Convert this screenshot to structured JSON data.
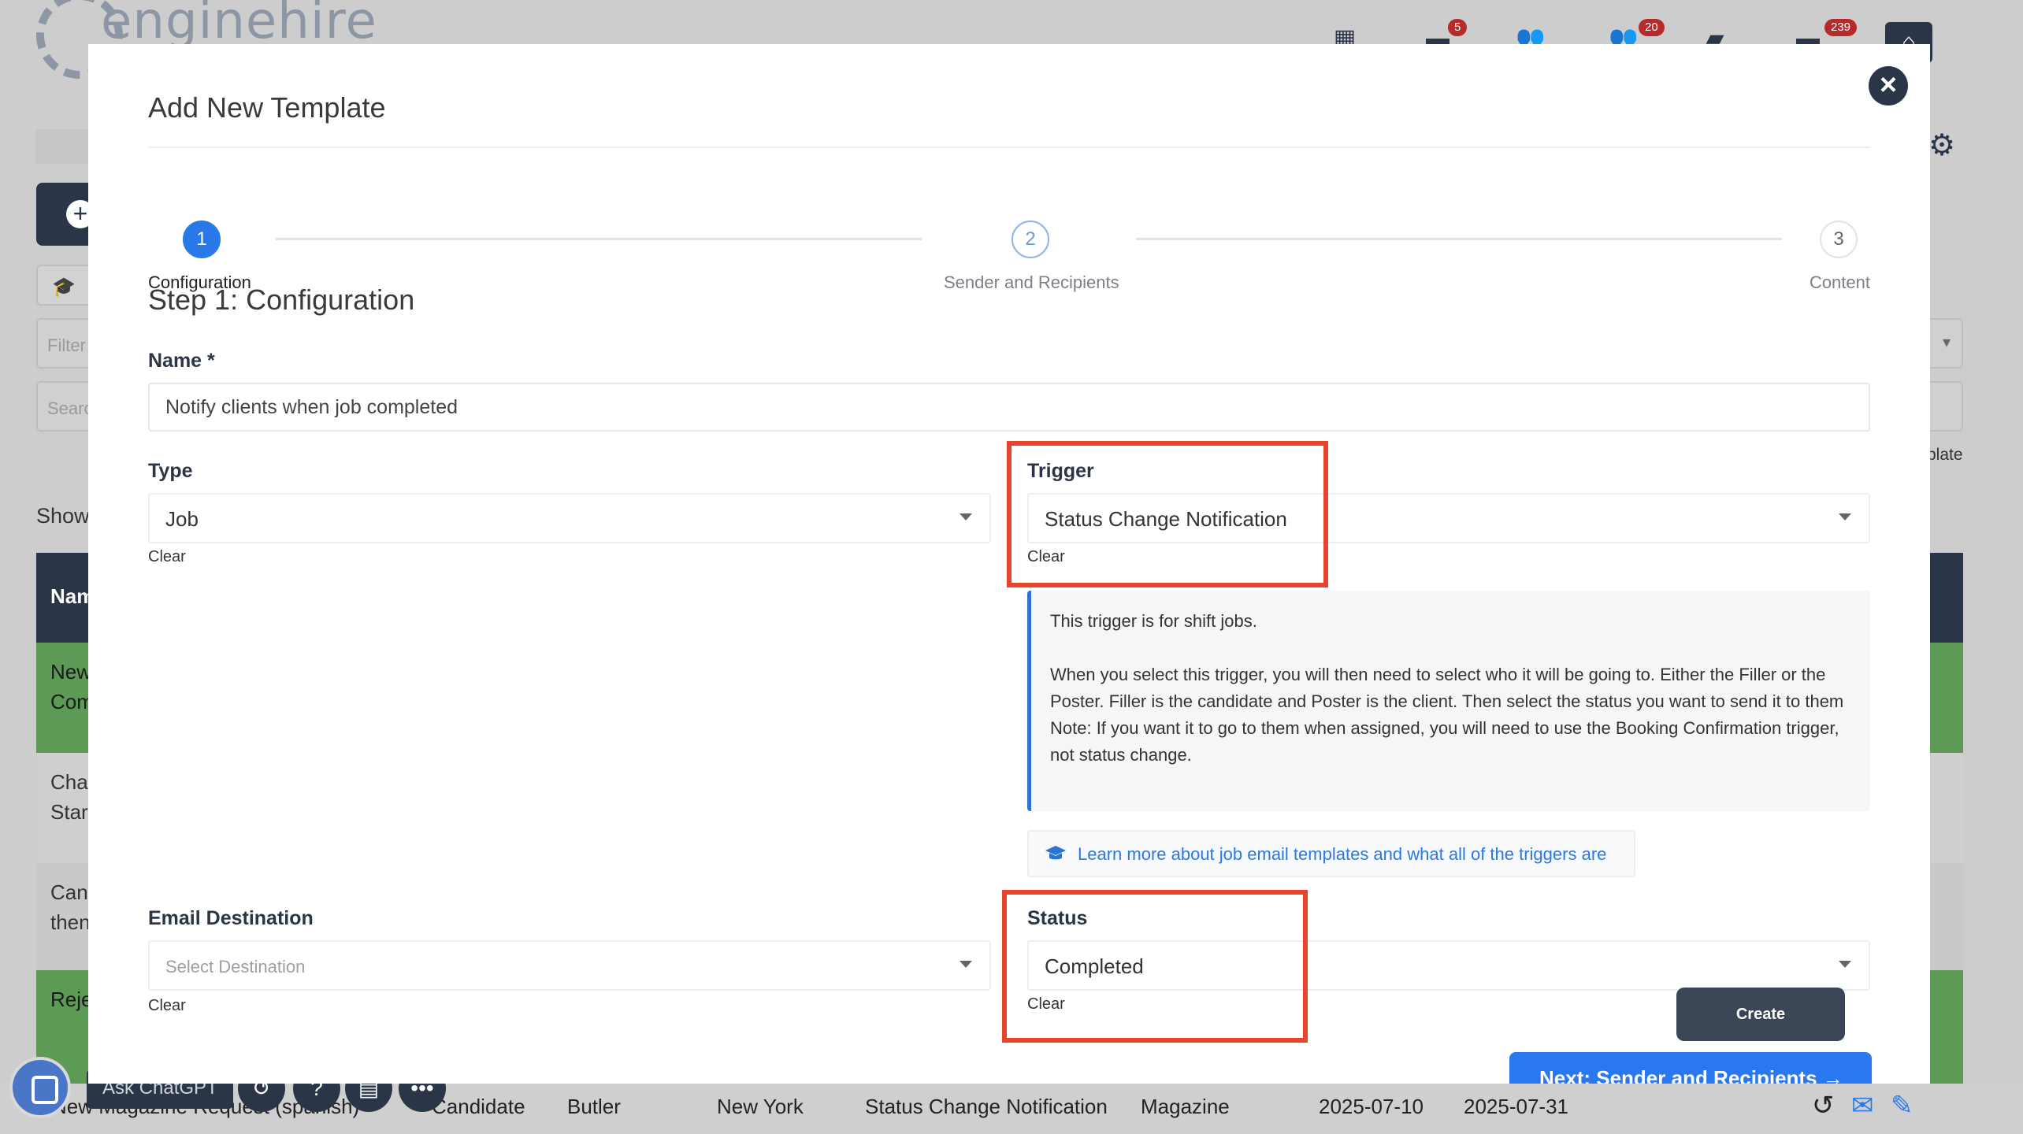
{
  "background": {
    "logo_text": "enginehire",
    "badges": {
      "messages": "5",
      "users": "20",
      "chat": "239"
    },
    "left_filter_placeholder": "Filter",
    "left_search_placeholder": "Search",
    "show_label": "Show",
    "table_header": "Nam",
    "rows": [
      "New Com",
      "Cha Star",
      "Can then",
      "Reje"
    ],
    "right_text": "plate",
    "bottom_row": {
      "name": "New Magazine Request (spanish)",
      "recipient": "Candidate",
      "role": "Butler",
      "location": "New York",
      "trigger": "Status Change Notification",
      "category": "Magazine",
      "start_date": "2025-07-10",
      "end_date": "2025-07-31"
    },
    "ask_chatgpt": "Ask ChatGPT"
  },
  "modal": {
    "title": "Add New Template",
    "stepper": {
      "steps": [
        {
          "number": "1",
          "label": "Configuration"
        },
        {
          "number": "2",
          "label": "Sender and Recipients"
        },
        {
          "number": "3",
          "label": "Content"
        }
      ]
    },
    "step_heading": "Step 1: Configuration",
    "name_field": {
      "label": "Name *",
      "value": "Notify clients when job completed"
    },
    "type_field": {
      "label": "Type",
      "value": "Job",
      "clear": "Clear"
    },
    "trigger_field": {
      "label": "Trigger",
      "value": "Status Change Notification",
      "clear": "Clear"
    },
    "info": {
      "line1": "This trigger is for shift jobs.",
      "line2": "When you select this trigger, you will then need to select who it will be going to. Either the Filler or the Poster. Filler is the candidate and Poster is the client. Then select the status you want to send it to them",
      "line3": "Note: If you want it to go to them when assigned, you will need to use the Booking Confirmation trigger, not status change."
    },
    "learn_link": "Learn more about job email templates and what all of the triggers are",
    "email_destination": {
      "label": "Email Destination",
      "placeholder": "Select Destination",
      "clear": "Clear"
    },
    "status_field": {
      "label": "Status",
      "value": "Completed",
      "clear": "Clear"
    },
    "create_button": "Create",
    "next_button": "Next: Sender and Recipients →",
    "colors": {
      "accent": "#2878e8",
      "highlight": "#e8432d",
      "dark": "#2a3547"
    }
  }
}
